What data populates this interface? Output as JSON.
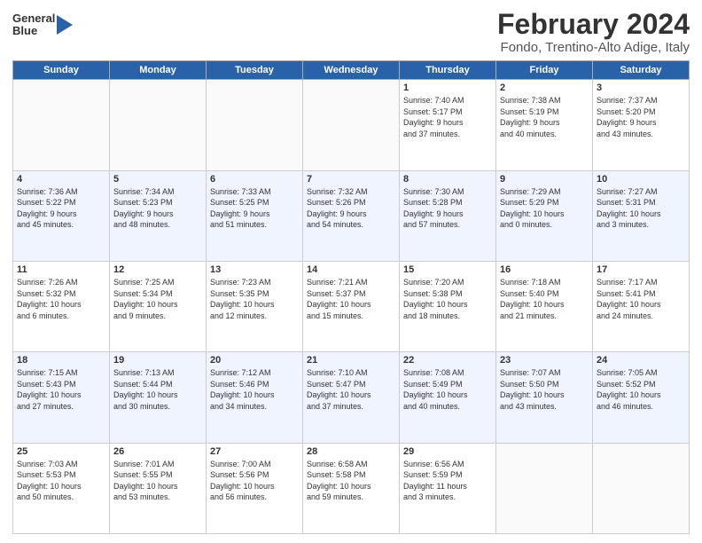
{
  "logo": {
    "line1": "General",
    "line2": "Blue"
  },
  "title": "February 2024",
  "subtitle": "Fondo, Trentino-Alto Adige, Italy",
  "headers": [
    "Sunday",
    "Monday",
    "Tuesday",
    "Wednesday",
    "Thursday",
    "Friday",
    "Saturday"
  ],
  "weeks": [
    [
      {
        "num": "",
        "info": ""
      },
      {
        "num": "",
        "info": ""
      },
      {
        "num": "",
        "info": ""
      },
      {
        "num": "",
        "info": ""
      },
      {
        "num": "1",
        "info": "Sunrise: 7:40 AM\nSunset: 5:17 PM\nDaylight: 9 hours\nand 37 minutes."
      },
      {
        "num": "2",
        "info": "Sunrise: 7:38 AM\nSunset: 5:19 PM\nDaylight: 9 hours\nand 40 minutes."
      },
      {
        "num": "3",
        "info": "Sunrise: 7:37 AM\nSunset: 5:20 PM\nDaylight: 9 hours\nand 43 minutes."
      }
    ],
    [
      {
        "num": "4",
        "info": "Sunrise: 7:36 AM\nSunset: 5:22 PM\nDaylight: 9 hours\nand 45 minutes."
      },
      {
        "num": "5",
        "info": "Sunrise: 7:34 AM\nSunset: 5:23 PM\nDaylight: 9 hours\nand 48 minutes."
      },
      {
        "num": "6",
        "info": "Sunrise: 7:33 AM\nSunset: 5:25 PM\nDaylight: 9 hours\nand 51 minutes."
      },
      {
        "num": "7",
        "info": "Sunrise: 7:32 AM\nSunset: 5:26 PM\nDaylight: 9 hours\nand 54 minutes."
      },
      {
        "num": "8",
        "info": "Sunrise: 7:30 AM\nSunset: 5:28 PM\nDaylight: 9 hours\nand 57 minutes."
      },
      {
        "num": "9",
        "info": "Sunrise: 7:29 AM\nSunset: 5:29 PM\nDaylight: 10 hours\nand 0 minutes."
      },
      {
        "num": "10",
        "info": "Sunrise: 7:27 AM\nSunset: 5:31 PM\nDaylight: 10 hours\nand 3 minutes."
      }
    ],
    [
      {
        "num": "11",
        "info": "Sunrise: 7:26 AM\nSunset: 5:32 PM\nDaylight: 10 hours\nand 6 minutes."
      },
      {
        "num": "12",
        "info": "Sunrise: 7:25 AM\nSunset: 5:34 PM\nDaylight: 10 hours\nand 9 minutes."
      },
      {
        "num": "13",
        "info": "Sunrise: 7:23 AM\nSunset: 5:35 PM\nDaylight: 10 hours\nand 12 minutes."
      },
      {
        "num": "14",
        "info": "Sunrise: 7:21 AM\nSunset: 5:37 PM\nDaylight: 10 hours\nand 15 minutes."
      },
      {
        "num": "15",
        "info": "Sunrise: 7:20 AM\nSunset: 5:38 PM\nDaylight: 10 hours\nand 18 minutes."
      },
      {
        "num": "16",
        "info": "Sunrise: 7:18 AM\nSunset: 5:40 PM\nDaylight: 10 hours\nand 21 minutes."
      },
      {
        "num": "17",
        "info": "Sunrise: 7:17 AM\nSunset: 5:41 PM\nDaylight: 10 hours\nand 24 minutes."
      }
    ],
    [
      {
        "num": "18",
        "info": "Sunrise: 7:15 AM\nSunset: 5:43 PM\nDaylight: 10 hours\nand 27 minutes."
      },
      {
        "num": "19",
        "info": "Sunrise: 7:13 AM\nSunset: 5:44 PM\nDaylight: 10 hours\nand 30 minutes."
      },
      {
        "num": "20",
        "info": "Sunrise: 7:12 AM\nSunset: 5:46 PM\nDaylight: 10 hours\nand 34 minutes."
      },
      {
        "num": "21",
        "info": "Sunrise: 7:10 AM\nSunset: 5:47 PM\nDaylight: 10 hours\nand 37 minutes."
      },
      {
        "num": "22",
        "info": "Sunrise: 7:08 AM\nSunset: 5:49 PM\nDaylight: 10 hours\nand 40 minutes."
      },
      {
        "num": "23",
        "info": "Sunrise: 7:07 AM\nSunset: 5:50 PM\nDaylight: 10 hours\nand 43 minutes."
      },
      {
        "num": "24",
        "info": "Sunrise: 7:05 AM\nSunset: 5:52 PM\nDaylight: 10 hours\nand 46 minutes."
      }
    ],
    [
      {
        "num": "25",
        "info": "Sunrise: 7:03 AM\nSunset: 5:53 PM\nDaylight: 10 hours\nand 50 minutes."
      },
      {
        "num": "26",
        "info": "Sunrise: 7:01 AM\nSunset: 5:55 PM\nDaylight: 10 hours\nand 53 minutes."
      },
      {
        "num": "27",
        "info": "Sunrise: 7:00 AM\nSunset: 5:56 PM\nDaylight: 10 hours\nand 56 minutes."
      },
      {
        "num": "28",
        "info": "Sunrise: 6:58 AM\nSunset: 5:58 PM\nDaylight: 10 hours\nand 59 minutes."
      },
      {
        "num": "29",
        "info": "Sunrise: 6:56 AM\nSunset: 5:59 PM\nDaylight: 11 hours\nand 3 minutes."
      },
      {
        "num": "",
        "info": ""
      },
      {
        "num": "",
        "info": ""
      }
    ]
  ]
}
